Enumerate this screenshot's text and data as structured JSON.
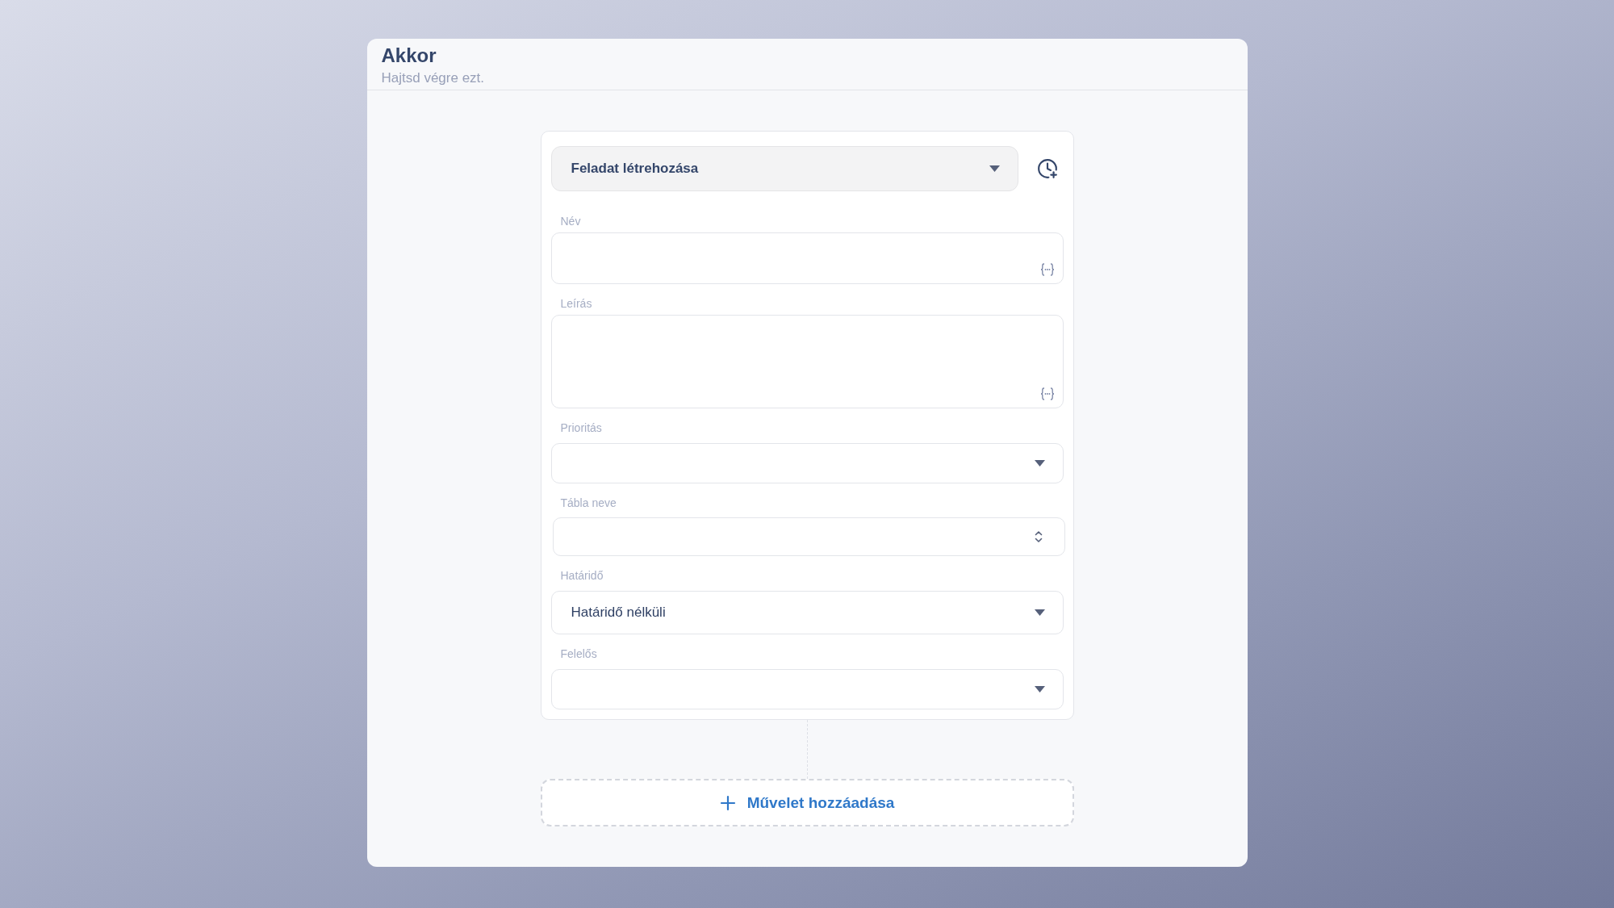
{
  "header": {
    "title": "Akkor",
    "subtitle": "Hajtsd végre ezt."
  },
  "action": {
    "value": "Feladat létrehozása"
  },
  "fields": [
    {
      "label": "Név",
      "kind": "text"
    },
    {
      "label": "Leírás",
      "kind": "textarea"
    },
    {
      "label": "Prioritás",
      "kind": "select"
    },
    {
      "label": "Tábla neve",
      "kind": "combobox"
    },
    {
      "label": "Határidő",
      "kind": "select",
      "value": "Határidő nélküli"
    },
    {
      "label": "Felelős",
      "kind": "select"
    }
  ],
  "add_button": {
    "label": "Művelet hozzáadása"
  }
}
